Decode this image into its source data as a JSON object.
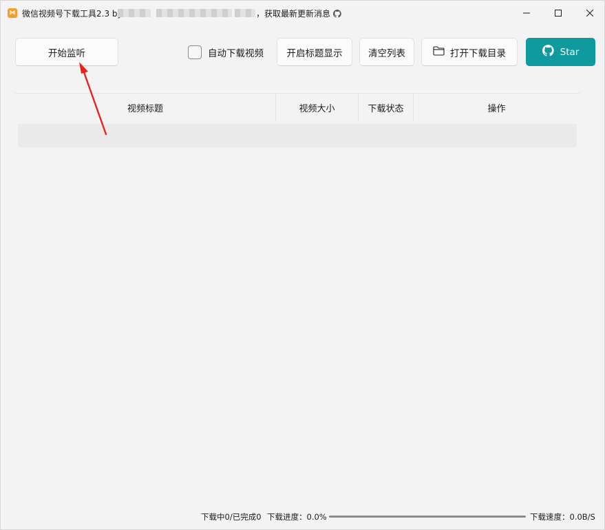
{
  "window": {
    "title_prefix": "微信视频号下载工具2.3 by",
    "title_suffix": "，获取最新更新消息",
    "app_icon": "app-logo-icon",
    "controls": [
      "minimize-icon",
      "maximize-icon",
      "close-icon"
    ]
  },
  "toolbar": {
    "start_label": "开始监听",
    "auto_download_label": "自动下载视频",
    "auto_download_checked": false,
    "show_title_label": "开启标题显示",
    "clear_label": "清空列表",
    "open_dir_label": "打开下载目录",
    "star_label": "Star",
    "accent": "#0f9a9f"
  },
  "table": {
    "columns": [
      "视频标题",
      "视频大小",
      "下载状态",
      "操作"
    ],
    "rows": []
  },
  "status": {
    "counts": "下载中0/已完成0",
    "progress_label": "下载进度：0.0%",
    "progress_fraction": 0.0,
    "speed": "下载速度：0.0B/S"
  }
}
